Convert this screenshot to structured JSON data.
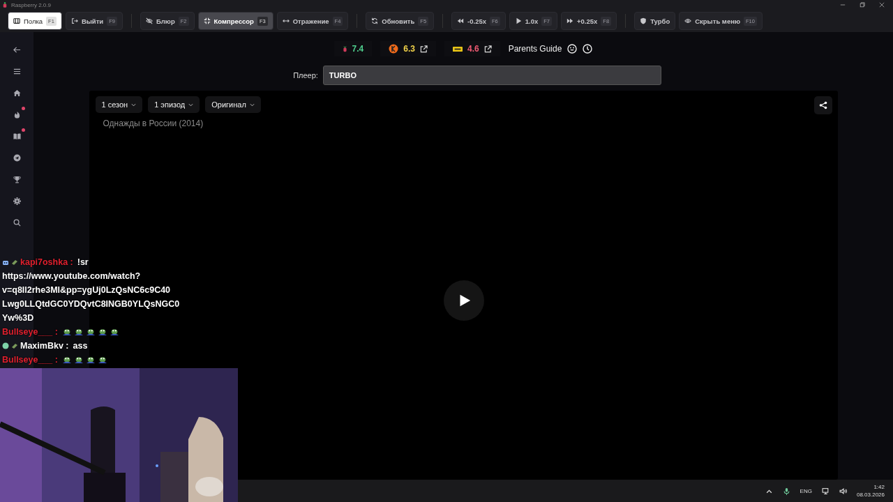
{
  "window": {
    "title": "Raspberry 2.0.9"
  },
  "toolbar": {
    "groups": [
      [
        {
          "label": "Полка",
          "key": "F1",
          "selected": true,
          "on": false
        },
        {
          "label": "Выйти",
          "key": "F9",
          "selected": false,
          "on": false
        }
      ],
      [
        {
          "label": "Блюр",
          "key": "F2",
          "selected": false,
          "on": false
        },
        {
          "label": "Компрессор",
          "key": "F3",
          "selected": false,
          "on": true
        },
        {
          "label": "Отражение",
          "key": "F4",
          "selected": false,
          "on": false
        }
      ],
      [
        {
          "label": "Обновить",
          "key": "F5",
          "selected": false,
          "on": false
        }
      ],
      [
        {
          "label": "-0.25x",
          "key": "F6",
          "selected": false,
          "on": false
        },
        {
          "label": "1.0x",
          "key": "F7",
          "selected": false,
          "on": false
        },
        {
          "label": "+0.25x",
          "key": "F8",
          "selected": false,
          "on": false
        }
      ],
      [
        {
          "label": "Турбо",
          "selected": false,
          "on": false
        },
        {
          "label": "Скрыть меню",
          "key": "F10",
          "selected": false,
          "on": false
        }
      ]
    ]
  },
  "sidebar": {
    "items": [
      {
        "badge": false
      },
      {
        "badge": false
      },
      {
        "badge": false
      },
      {
        "badge": true
      },
      {
        "badge": true
      },
      {
        "badge": false
      },
      {
        "badge": false
      },
      {
        "badge": false
      },
      {
        "badge": false
      }
    ]
  },
  "ratings": [
    {
      "value": "7.4",
      "color": "#4fcf8e",
      "link": false
    },
    {
      "value": "6.3",
      "color": "#f2d34a",
      "link": true
    },
    {
      "value": "4.6",
      "color": "#ee5a72",
      "link": true
    }
  ],
  "parents_guide": "Parents Guide",
  "player": {
    "label": "Плеер:",
    "value": "TURBO"
  },
  "video": {
    "selects": [
      "1 сезон",
      "1 эпизод",
      "Оригинал"
    ],
    "title": "Однажды в России (2014)"
  },
  "chat": [
    {
      "user": "kapi7oshka :",
      "color": "#e0202e",
      "badges": [
        {
          "kind": "bot"
        },
        {
          "kind": "gem"
        }
      ],
      "text": "!sr",
      "continuation": [
        "https://www.youtube.com/watch?",
        "v=q8Il2rhe3MI&pp=ygUj0LzQsNC6c9C40",
        "Lwg0LLQtdGC0YDQvtC8INGB0YLQsNGC0",
        "Yw%3D"
      ]
    },
    {
      "user": "Bullseye___ :",
      "color": "#e0202e",
      "emotes": [
        {
          "kind": "frog"
        },
        {
          "kind": "frog"
        },
        {
          "kind": "frog"
        },
        {
          "kind": "frog"
        },
        {
          "kind": "frog"
        }
      ]
    },
    {
      "user": "MaximBkv :",
      "color": "#ffffff",
      "badges": [
        {
          "kind": "face"
        },
        {
          "kind": "gem"
        }
      ],
      "text": "ass"
    },
    {
      "user": "Bullseye___ :",
      "color": "#e0202e",
      "emotes": [
        {
          "kind": "frog"
        },
        {
          "kind": "frog"
        },
        {
          "kind": "frog"
        },
        {
          "kind": "frog"
        }
      ]
    }
  ],
  "taskbar": {
    "language": "ENG",
    "time": "1:42",
    "date": "08.03.2026"
  }
}
